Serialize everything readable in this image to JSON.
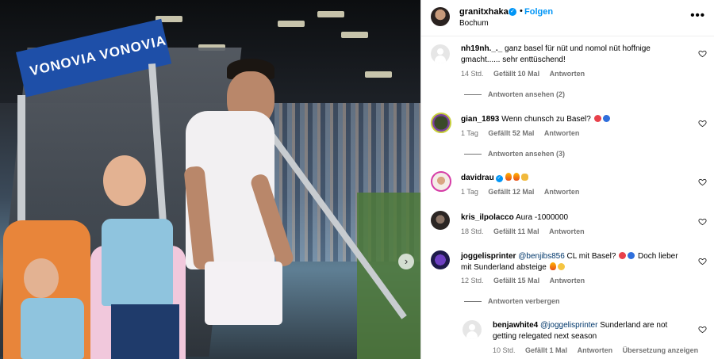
{
  "post": {
    "username": "granitxhaka",
    "separator": "•",
    "follow_label": "Folgen",
    "location": "Bochum",
    "more_label": "•••"
  },
  "photo": {
    "stadium_sign_text": "VONOVIA VONOVIA",
    "next_label": "›"
  },
  "comments": [
    {
      "username": "nh19nh._._",
      "text": "ganz basel für nüt und nomol nüt hoffnige gmacht...... sehr enttüschend!",
      "time": "14 Std.",
      "likes": "Gefällt 10 Mal",
      "reply": "Antworten",
      "view_replies": "Antworten ansehen (2)"
    },
    {
      "username": "gian_1893",
      "text": "Wenn chunsch zu Basel?",
      "time": "1 Tag",
      "likes": "Gefällt 52 Mal",
      "reply": "Antworten",
      "view_replies": "Antworten ansehen (3)"
    },
    {
      "username": "davidrau",
      "text": "",
      "time": "1 Tag",
      "likes": "Gefällt 12 Mal",
      "reply": "Antworten"
    },
    {
      "username": "kris_ilpolacco",
      "text": "Aura -1000000",
      "time": "18 Std.",
      "likes": "Gefällt 11 Mal",
      "reply": "Antworten"
    },
    {
      "username": "joggelisprinter",
      "mention": "@benjibs856",
      "text": "CL mit Basel?",
      "text_2": "Doch lieber mit Sunderland absteige",
      "time": "12 Std.",
      "likes": "Gefällt 15 Mal",
      "reply": "Antworten",
      "hide_replies": "Antworten verbergen"
    },
    {
      "username": "benjawhite4",
      "mention": "@joggelisprinter",
      "text": "Sunderland are not getting relegated next season",
      "time": "10 Std.",
      "likes": "Gefällt 1 Mal",
      "reply": "Antworten",
      "translate": "Übersetzung anzeigen"
    }
  ],
  "colors": {
    "accent": "#0095f6",
    "meta_text": "#737373",
    "mention": "#00376b"
  }
}
